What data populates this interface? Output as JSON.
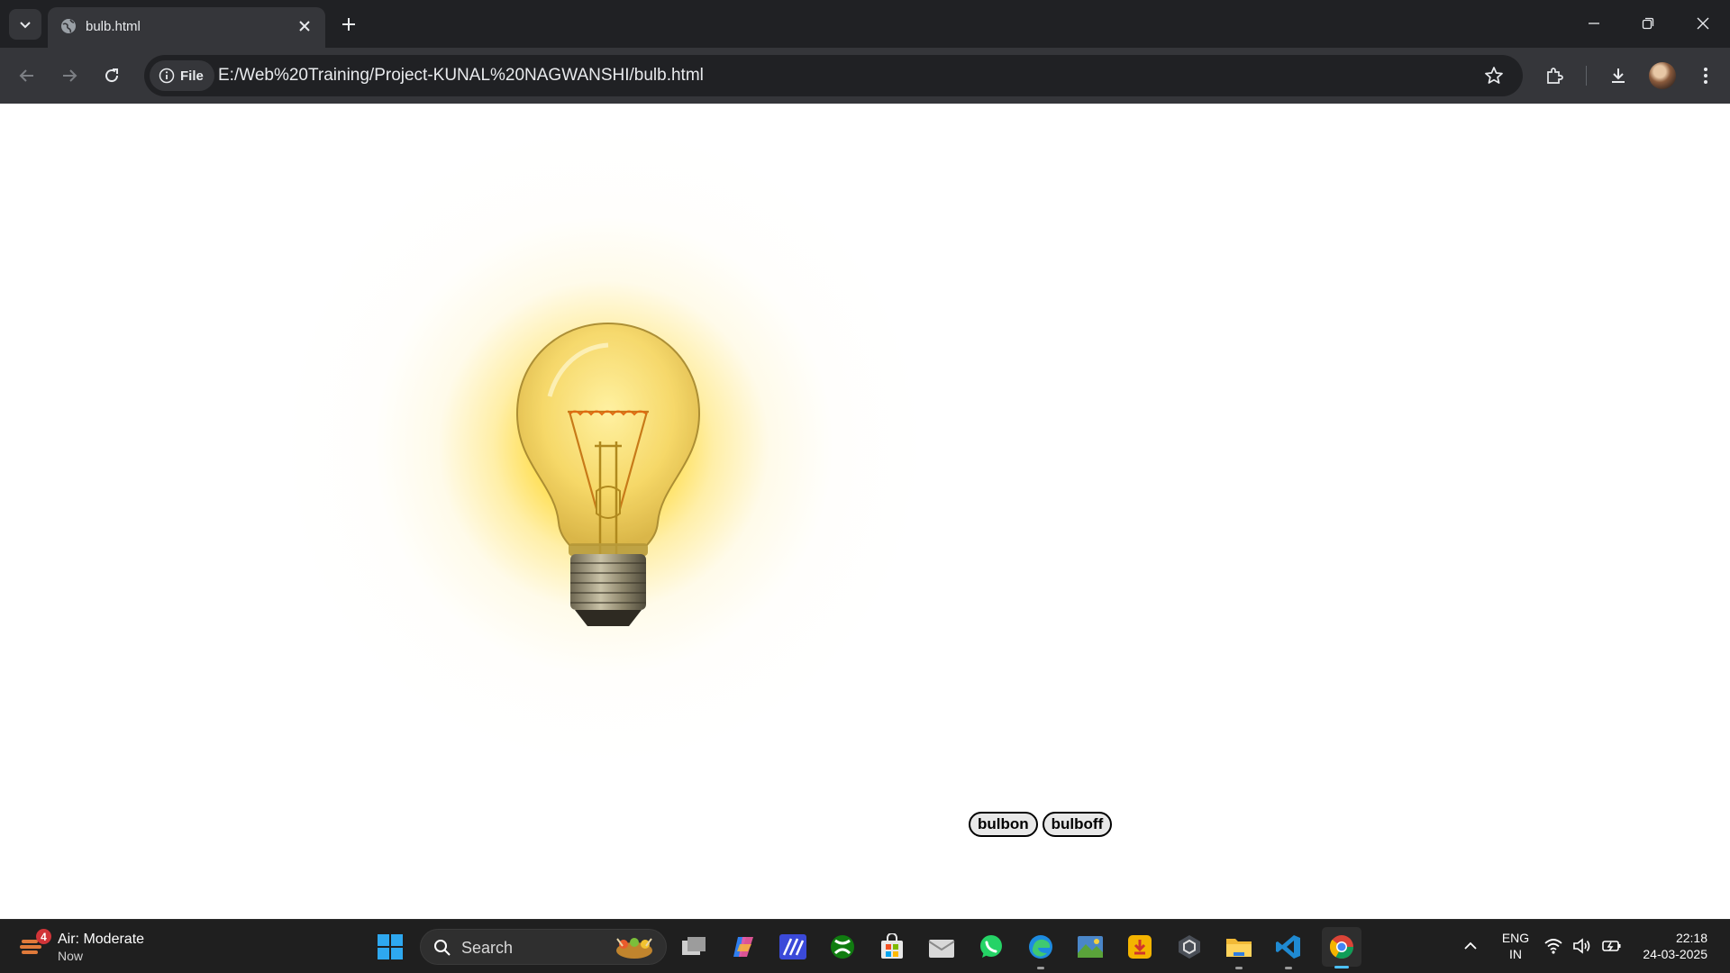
{
  "browser": {
    "tab": {
      "title": "bulb.html",
      "favicon": "globe-icon"
    },
    "address_bar": {
      "chip_label": "File",
      "url": "E:/Web%20Training/Project-KUNAL%20NAGWANSHI/bulb.html"
    }
  },
  "page": {
    "buttons": {
      "on_label": "bulbon",
      "off_label": "bulboff"
    },
    "bulb_state": "on",
    "glow_color": "#FFD628"
  },
  "taskbar": {
    "weather": {
      "badge": "4",
      "title": "Air: Moderate",
      "subtitle": "Now"
    },
    "search": {
      "label": "Search"
    },
    "apps": [
      "task-view",
      "copilot",
      "edit-app",
      "xbox",
      "microsoft-store",
      "mail",
      "whatsapp",
      "edge",
      "photos",
      "downloader",
      "unity",
      "file-explorer",
      "vscode",
      "chrome"
    ],
    "language": {
      "line1": "ENG",
      "line2": "IN"
    },
    "clock": {
      "time": "22:18",
      "date": "24-03-2025"
    }
  },
  "colors": {
    "titlebar": "#202124",
    "toolbar": "#35363a",
    "taskbar": "#1f1f1f",
    "accent": "#4cc2ff"
  }
}
